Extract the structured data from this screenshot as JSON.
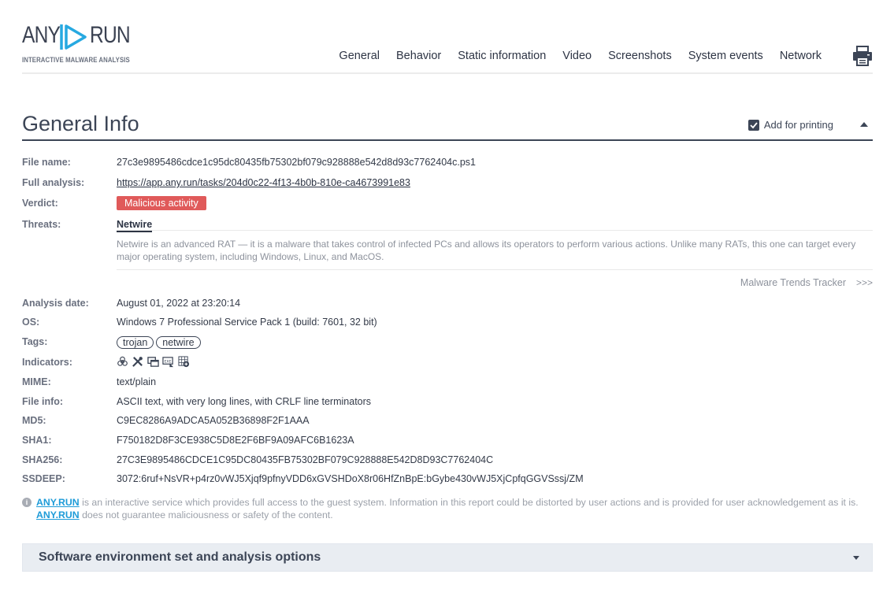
{
  "header": {
    "logo": {
      "left": "ANY",
      "right": "RUN",
      "subtitle": "INTERACTIVE MALWARE ANALYSIS"
    },
    "nav": [
      "General",
      "Behavior",
      "Static information",
      "Video",
      "Screenshots",
      "System events",
      "Network"
    ],
    "print_icon": "printer-icon"
  },
  "section": {
    "title": "General Info",
    "add_for_printing": "Add for printing",
    "add_for_printing_checked": true
  },
  "info": {
    "file_name": {
      "label": "File name:",
      "value": "27c3e9895486cdce1c95dc80435fb75302bf079c928888e542d8d93c7762404c.ps1"
    },
    "full_analysis": {
      "label": "Full analysis:",
      "value": "https://app.any.run/tasks/204d0c22-4f13-4b0b-810e-ca4673991e83"
    },
    "verdict": {
      "label": "Verdict:",
      "value": "Malicious activity",
      "color": "#e05a5a"
    },
    "threats": {
      "label": "Threats:",
      "name": "Netwire",
      "description": "Netwire is an advanced RAT — it is a malware that takes control of infected PCs and allows its operators to perform various actions. Unlike many RATs, this one can target every major operating system, including Windows, Linux, and MacOS.",
      "tracker_link": "Malware Trends Tracker",
      "tracker_arrow": ">>>"
    },
    "analysis_date": {
      "label": "Analysis date:",
      "value": "August 01, 2022 at 23:20:14"
    },
    "os": {
      "label": "OS:",
      "value": "Windows 7 Professional Service Pack 1 (build: 7601, 32 bit)"
    },
    "tags": {
      "label": "Tags:",
      "values": [
        "trojan",
        "netwire"
      ]
    },
    "indicators": {
      "label": "Indicators:",
      "icons": [
        "biohazard-icon",
        "tools-icon",
        "windows-icon",
        "exe-drop-icon",
        "network-icon"
      ]
    },
    "mime": {
      "label": "MIME:",
      "value": "text/plain"
    },
    "file_info": {
      "label": "File info:",
      "value": "ASCII text, with very long lines, with CRLF line terminators"
    },
    "md5": {
      "label": "MD5:",
      "value": "C9EC8286A9ADCA5A052B36898F2F1AAA"
    },
    "sha1": {
      "label": "SHA1:",
      "value": "F750182D8F3CE938C5D8E2F6BF9A09AFC6B1623A"
    },
    "sha256": {
      "label": "SHA256:",
      "value": "27C3E9895486CDCE1C95DC80435FB75302BF079C928888E542D8D93C7762404C"
    },
    "ssdeep": {
      "label": "SSDEEP:",
      "value": "3072:6ruf+NsVR+p4rz0vWJ5Xjqf9pfnyVDD6xGVSHDoX8r06HfZnBpE:bGybe430vWJ5XjCpfqGGVSssj/ZM"
    }
  },
  "disclaimer": {
    "link": "ANY.RUN",
    "line1": " is an interactive service which provides full access to the guest system. Information in this report could be distorted by user actions and is provided for user acknowledgement as it is.",
    "line2": " does not guarantee maliciousness or safety of the content."
  },
  "accordion": {
    "title": "Software environment set and analysis options"
  },
  "colors": {
    "brand_blue": "#1d9bd8",
    "text_dark": "#3c4556",
    "malicious": "#e05a5a"
  }
}
